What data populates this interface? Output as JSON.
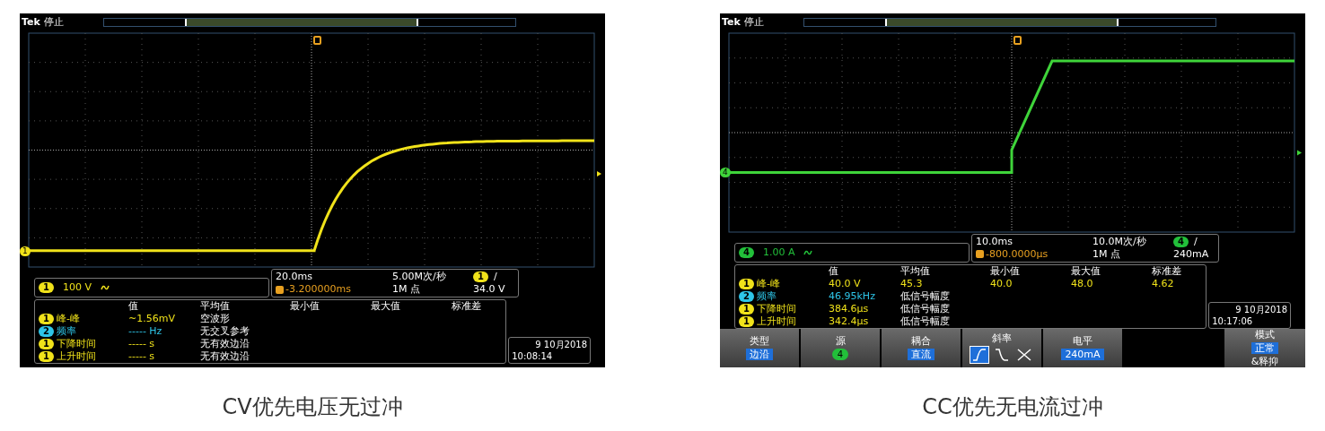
{
  "figures": [
    {
      "screen": {
        "brand": "Tek",
        "status": "停止",
        "trace": {
          "kind": "rc-rise",
          "color": "#f0e21a"
        },
        "marker": "1",
        "channel_box": {
          "badge": "1",
          "color": "#f0e21a",
          "scale": "100 V"
        },
        "timebase": {
          "scale": "20.0ms",
          "rate": "5.00M次/秒",
          "trigger_badge": "1",
          "trigger_slope": "/",
          "position": "-3.200000ms",
          "points": "1M 点",
          "trigger_level": "34.0 V"
        },
        "measurements": {
          "headers": [
            "值",
            "平均值",
            "最小值",
            "最大值",
            "标准差"
          ],
          "rows": [
            {
              "badge": "1",
              "color": "#f0e21a",
              "name": "峰-峰",
              "value": "~1.56mV",
              "note": "空波形"
            },
            {
              "badge": "2",
              "color": "#2ec5e8",
              "name": "频率",
              "value": "----- Hz",
              "note": "无交叉参考"
            },
            {
              "badge": "1",
              "color": "#f0e21a",
              "name": "下降时间",
              "value": "----- s",
              "note": "无有效边沿"
            },
            {
              "badge": "1",
              "color": "#f0e21a",
              "name": "上升时间",
              "value": "----- s",
              "note": "无有效边沿"
            }
          ]
        },
        "date": "9 10月2018",
        "time": "10:08:14"
      },
      "caption": "CV优先电压无过冲"
    },
    {
      "screen": {
        "brand": "Tek",
        "status": "停止",
        "trace": {
          "kind": "ramp-step",
          "color": "#3fd43a"
        },
        "marker": "4",
        "channel_box": {
          "badge": "4",
          "color": "#22c03a",
          "scale": "1.00 A"
        },
        "timebase": {
          "scale": "10.0ms",
          "rate": "10.0M次/秒",
          "trigger_badge": "4",
          "trigger_slope": "/",
          "position": "-800.0000μs",
          "points": "1M 点",
          "trigger_level": "240mA"
        },
        "measurements": {
          "headers": [
            "值",
            "平均值",
            "最小值",
            "最大值",
            "标准差"
          ],
          "rows": [
            {
              "badge": "1",
              "color": "#f0e21a",
              "name": "峰-峰",
              "value": "40.0 V",
              "stats": [
                "45.3",
                "40.0",
                "48.0",
                "4.62"
              ]
            },
            {
              "badge": "2",
              "color": "#2ec5e8",
              "name": "频率",
              "value": "46.95kHz",
              "note": "低信号幅度"
            },
            {
              "badge": "1",
              "color": "#f0e21a",
              "name": "下降时间",
              "value": "384.6μs",
              "note": "低信号幅度"
            },
            {
              "badge": "1",
              "color": "#f0e21a",
              "name": "上升时间",
              "value": "342.4μs",
              "note": "低信号幅度"
            }
          ]
        },
        "date": "9 10月2018",
        "time": "10:17:06",
        "menu": [
          {
            "kind": "value",
            "label": "类型",
            "value": "边沿"
          },
          {
            "kind": "channel",
            "label": "源",
            "value": "4",
            "color": "#22c03a"
          },
          {
            "kind": "value",
            "label": "耦合",
            "value": "直流"
          },
          {
            "kind": "slope",
            "label": "斜率",
            "options": [
              {
                "kind": "rising",
                "selected": true
              },
              {
                "kind": "falling",
                "selected": false
              },
              {
                "kind": "either",
                "selected": false
              }
            ]
          },
          {
            "kind": "value",
            "label": "电平",
            "value": "240mA"
          },
          {
            "kind": "blank"
          },
          {
            "kind": "mode",
            "label": "模式",
            "value": "正常",
            "extra": "&释抑"
          }
        ]
      },
      "caption": "CC优先无电流过冲"
    }
  ]
}
